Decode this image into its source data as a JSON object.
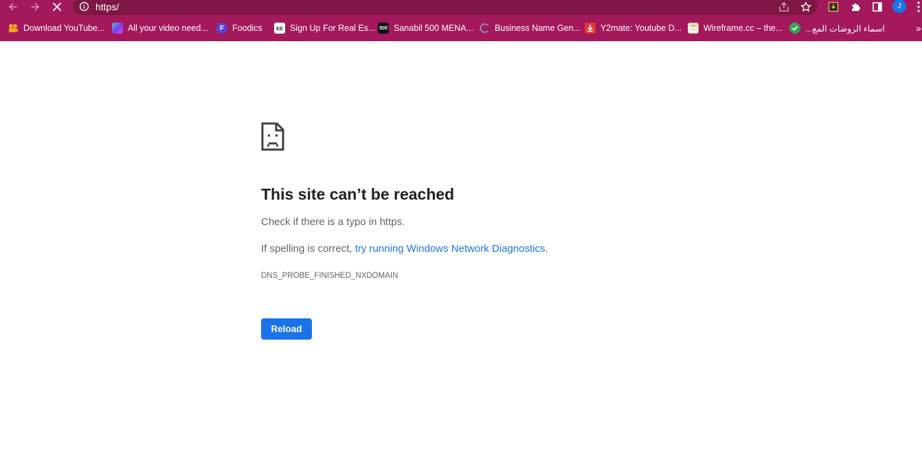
{
  "browser": {
    "url": "https/",
    "profile_initial": "J",
    "theme_color": "#a3195b",
    "omnibox_color": "#7e1745"
  },
  "bookmarks": [
    {
      "label": "Download YouTube...",
      "icon": "camera-icon",
      "color": "#f6a623"
    },
    {
      "label": "All your video need...",
      "icon": "video-app-icon",
      "color": "#7b3fe4"
    },
    {
      "label": "Foodics",
      "icon": "foodics-icon",
      "color": "#5b3fd9"
    },
    {
      "label": "Sign Up For Real Es...",
      "icon": "cc-icon",
      "color": "#ffffff"
    },
    {
      "label": "Sanabil 500 MENA...",
      "icon": "500-icon",
      "color": "#111111"
    },
    {
      "label": "Business Name Gen...",
      "icon": "business-icon",
      "color": "#6a6a8a"
    },
    {
      "label": "Y2mate: Youtube D...",
      "icon": "download-icon",
      "color": "#e53935"
    },
    {
      "label": "Wireframe.cc – the...",
      "icon": "wireframe-icon",
      "color": "#f4b183"
    },
    {
      "label": "اسماء الروضات المع...",
      "icon": "check-icon",
      "color": "#34a853"
    }
  ],
  "error": {
    "title": "This site can’t be reached",
    "line1": "Check if there is a typo in https.",
    "line2_prefix": "If spelling is correct, ",
    "line2_link": "try running Windows Network Diagnostics",
    "line2_suffix": ".",
    "code": "DNS_PROBE_FINISHED_NXDOMAIN",
    "reload_label": "Reload"
  }
}
